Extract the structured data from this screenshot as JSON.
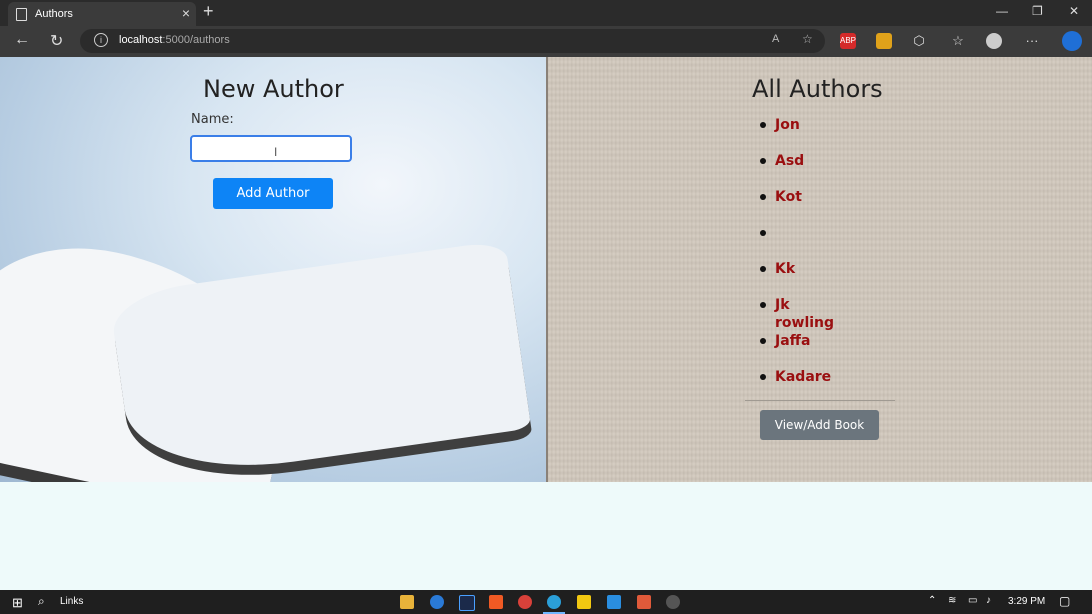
{
  "browser": {
    "tab_title": "Authors",
    "new_tab": "+",
    "url_host": "localhost",
    "url_rest": ":5000/authors",
    "controls": {
      "minimize": "—",
      "restore": "❐",
      "close": "✕"
    },
    "ext_labels": {
      "abp": "ABP"
    }
  },
  "left_panel": {
    "heading": "New Author",
    "name_label": "Name:",
    "name_value": "",
    "add_button": "Add Author"
  },
  "right_panel": {
    "heading": "All Authors",
    "authors": [
      "Jon",
      "Asd",
      "Kot",
      "",
      "Kk",
      "Jk rowling",
      "Jaffa",
      "Kadare"
    ],
    "view_button": "View/Add Book"
  },
  "taskbar": {
    "search_label": "Links",
    "time": "3:29 PM"
  },
  "colors": {
    "primary": "#0d84f6",
    "secondary": "#6b757d",
    "author_text": "#9a0f10"
  }
}
